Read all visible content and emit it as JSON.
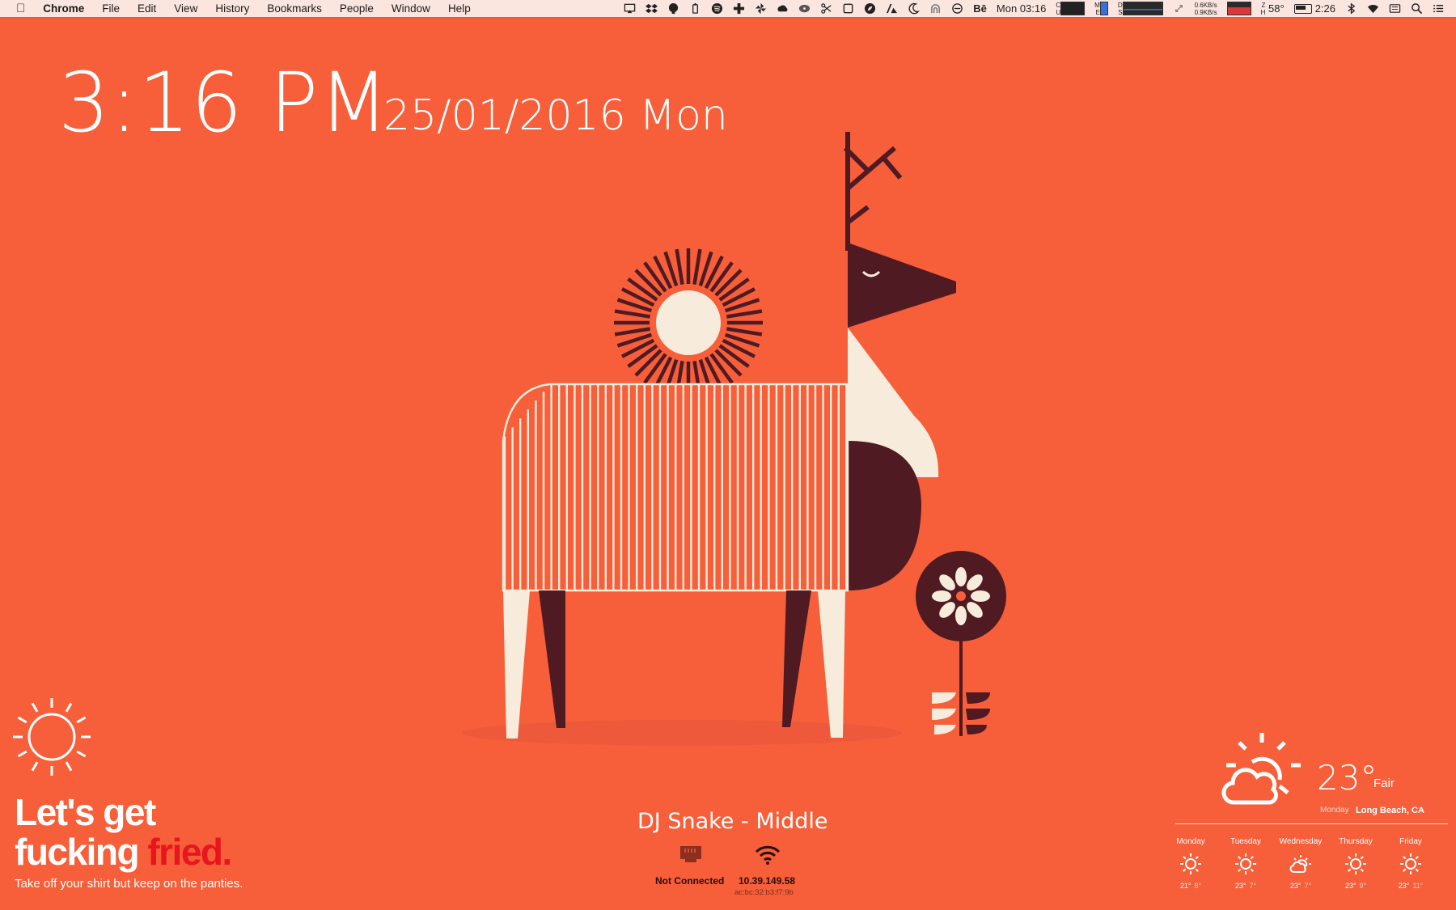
{
  "menubar": {
    "app": "Chrome",
    "menus": [
      "File",
      "Edit",
      "View",
      "History",
      "Bookmarks",
      "People",
      "Window",
      "Help"
    ],
    "net_up": "0.6KB/s",
    "net_down": "0.9KB/s",
    "clock": "Mon 03:16",
    "behance": "Bē",
    "temp": "58°",
    "battery_time": "2:26",
    "status_icons": [
      "airplay-icon",
      "dropbox-icon",
      "evernote-icon",
      "alfred-icon",
      "spotify-icon",
      "crossplatform-icon",
      "pinwheel-icon",
      "cloud-icon",
      "disc-icon",
      "scissors-icon",
      "box-icon",
      "leaf-icon",
      "adobe-icon",
      "moon-icon",
      "lock-arc-icon",
      "circle-icon"
    ]
  },
  "clock": {
    "time": "3:16 PM",
    "date": "25/01/2016 Mon"
  },
  "quote": {
    "line1": "Let's get",
    "line2_plain": "fucking ",
    "line2_accent": "fried.",
    "subtitle": "Take off your shirt but keep on the panties.",
    "accent_color": "#e8141e"
  },
  "music": {
    "now_playing": "DJ Snake - Middle"
  },
  "network": {
    "ethernet_status": "Not Connected",
    "wifi_ip": "10.39.149.58",
    "wifi_mac": "ac:bc:32:b3:f7:9b"
  },
  "weather": {
    "temp": "23°",
    "condition": "Fair",
    "day": "Monday",
    "location": "Long Beach, CA",
    "forecast": [
      {
        "day": "Monday",
        "icon": "sun-icon",
        "high": "21°",
        "low": "8°"
      },
      {
        "day": "Tuesday",
        "icon": "sun-icon",
        "high": "23°",
        "low": "7°"
      },
      {
        "day": "Wednesday",
        "icon": "partly-cloudy-icon",
        "high": "23°",
        "low": "7°"
      },
      {
        "day": "Thursday",
        "icon": "sun-icon",
        "high": "23°",
        "low": "9°"
      },
      {
        "day": "Friday",
        "icon": "sun-icon",
        "high": "23°",
        "low": "11°"
      }
    ]
  },
  "colors": {
    "background": "#f65f3a",
    "dark": "#4f1a22",
    "cream": "#f7ecdc"
  }
}
